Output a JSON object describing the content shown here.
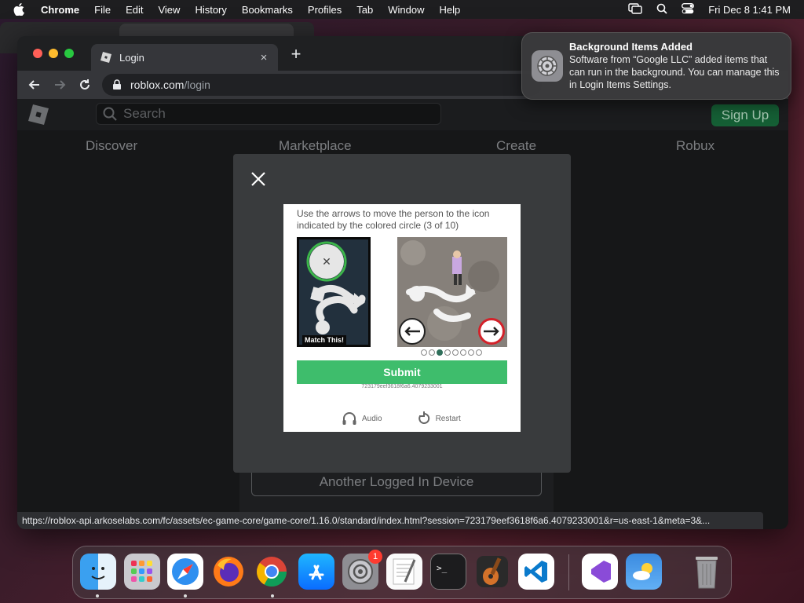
{
  "menubar": {
    "app_name": "Chrome",
    "items": [
      "File",
      "Edit",
      "View",
      "History",
      "Bookmarks",
      "Profiles",
      "Tab",
      "Window",
      "Help"
    ],
    "clock": "Fri Dec 8  1:41 PM"
  },
  "browser": {
    "tab_title": "Login",
    "tab_close": "×",
    "new_tab": "+",
    "url_host": "roblox.com",
    "url_path": "/login",
    "status_url": "https://roblox-api.arkoselabs.com/fc/assets/ec-game-core/game-core/1.16.0/standard/index.html?session=723179eef3618f6a6.4079233001&r=us-east-1&meta=3&..."
  },
  "roblox": {
    "search_placeholder": "Search",
    "signup_label": "Sign Up",
    "nav": [
      "Discover",
      "Marketplace",
      "Create",
      "Robux"
    ],
    "another_device_label": "Another Logged In Device"
  },
  "captcha": {
    "instruction": "Use the arrows to move the person to the icon indicated by the colored circle (3 of 10)",
    "match_label": "Match This!",
    "progress_current": 3,
    "progress_total": 8,
    "submit_label": "Submit",
    "session_id": "723179eef3618f6a6.4079233001",
    "audio_label": "Audio",
    "restart_label": "Restart"
  },
  "notification": {
    "title": "Background Items Added",
    "body": "Software from “Google LLC” added items that can run in the background. You can manage this in Login Items Settings."
  },
  "dock": {
    "apps": [
      "Finder",
      "Launchpad",
      "Safari",
      "Firefox",
      "Google Chrome",
      "App Store",
      "System Settings",
      "TextEdit",
      "Terminal",
      "GarageBand",
      "Visual Studio Code",
      "Visual Studio",
      "Weather",
      "Trash"
    ],
    "settings_badge": "1"
  },
  "colors": {
    "submit_green": "#3ebd6c",
    "signup_green": "#155f35",
    "notification_bg": "#3a3a3c"
  }
}
